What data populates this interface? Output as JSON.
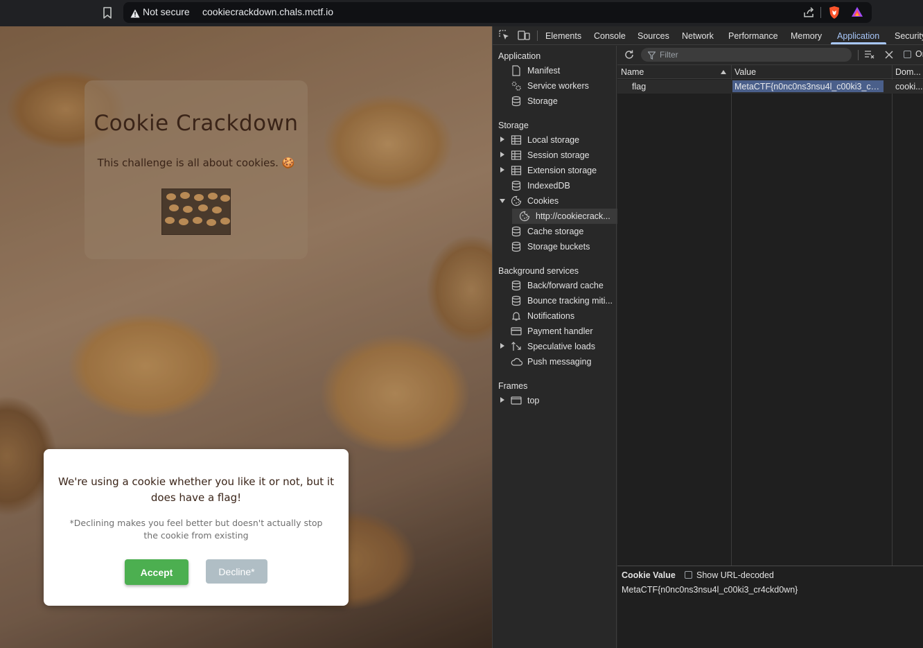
{
  "browser": {
    "security_label": "Not secure",
    "url": "cookiecrackdown.chals.mctf.io"
  },
  "page": {
    "title": "Cookie Crackdown",
    "subtitle": "This challenge is all about cookies. 🍪",
    "consent": {
      "message": "We're using a cookie whether you like it or not, but it does have a flag!",
      "note": "*Declining makes you feel better but doesn't actually stop the cookie from existing",
      "accept_label": "Accept",
      "decline_label": "Decline*"
    }
  },
  "devtools": {
    "tabs": [
      "Elements",
      "Console",
      "Sources",
      "Network",
      "Performance",
      "Memory",
      "Application",
      "Security"
    ],
    "active_tab": "Application",
    "accent_color": "#a8c7fa",
    "sidebar": {
      "application_header": "Application",
      "application_items": [
        {
          "label": "Manifest",
          "icon": "file-icon"
        },
        {
          "label": "Service workers",
          "icon": "gears-icon"
        },
        {
          "label": "Storage",
          "icon": "database-icon"
        }
      ],
      "storage_header": "Storage",
      "storage_items": [
        {
          "label": "Local storage",
          "icon": "table-icon"
        },
        {
          "label": "Session storage",
          "icon": "table-icon"
        },
        {
          "label": "Extension storage",
          "icon": "table-icon"
        },
        {
          "label": "IndexedDB",
          "icon": "database-icon"
        },
        {
          "label": "Cookies",
          "icon": "cookie-icon"
        },
        {
          "label": "http://cookiecrack...",
          "icon": "cookie-icon"
        },
        {
          "label": "Cache storage",
          "icon": "database-icon"
        },
        {
          "label": "Storage buckets",
          "icon": "database-icon"
        }
      ],
      "background_header": "Background services",
      "background_items": [
        {
          "label": "Back/forward cache",
          "icon": "database-icon"
        },
        {
          "label": "Bounce tracking miti...",
          "icon": "database-icon"
        },
        {
          "label": "Notifications",
          "icon": "bell-icon"
        },
        {
          "label": "Payment handler",
          "icon": "card-icon"
        },
        {
          "label": "Speculative loads",
          "icon": "arrows-icon"
        },
        {
          "label": "Push messaging",
          "icon": "cloud-icon"
        }
      ],
      "frames_header": "Frames",
      "frames_items": [
        {
          "label": "top",
          "icon": "frame-icon"
        }
      ]
    },
    "cookies": {
      "filter_placeholder": "Filter",
      "only_label": "Or",
      "columns": [
        "Name",
        "Value",
        "Dom..."
      ],
      "rows": [
        {
          "name": "flag",
          "value": "MetaCTF{n0nc0ns3nsu4l_c00ki3_cr4ckd0...",
          "domain": "cooki..."
        }
      ],
      "cookie_value_title": "Cookie Value",
      "show_decoded_label": "Show URL-decoded",
      "cookie_value": "MetaCTF{n0nc0ns3nsu4l_c00ki3_cr4ckd0wn}"
    }
  }
}
